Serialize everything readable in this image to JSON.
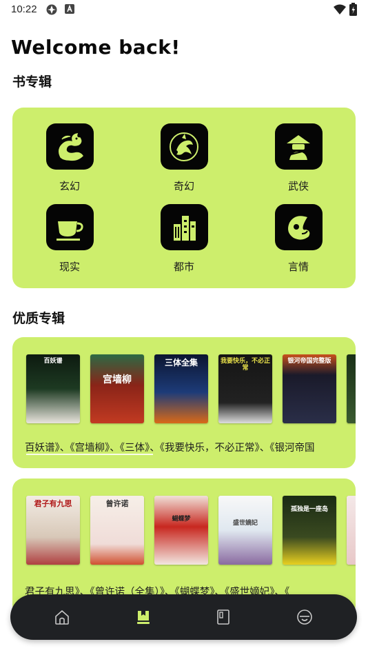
{
  "status_bar": {
    "time": "10:22"
  },
  "welcome": "Welcome back!",
  "section_categories": {
    "title": "书专辑"
  },
  "categories": [
    {
      "label": "玄幻",
      "icon": "dragon-icon"
    },
    {
      "label": "奇幻",
      "icon": "wyvern-icon"
    },
    {
      "label": "武侠",
      "icon": "martial-artist-icon"
    },
    {
      "label": "现实",
      "icon": "teacup-icon"
    },
    {
      "label": "都市",
      "icon": "city-buildings-icon"
    },
    {
      "label": "言情",
      "icon": "romance-swirl-icon"
    }
  ],
  "section_albums": {
    "title": "优质专辑"
  },
  "albums": [
    {
      "books": [
        {
          "cover_text": "百妖谱"
        },
        {
          "cover_text": "宫墙柳"
        },
        {
          "cover_text": "三体全集"
        },
        {
          "cover_text": "我要快乐，不必正常"
        },
        {
          "cover_text": "银河帝国完整版"
        },
        {
          "cover_text": ""
        }
      ],
      "caption": "百妖谱》、《宫墙柳》、《三体》、《我要快乐，不必正常》、《银河帝国"
    },
    {
      "books": [
        {
          "cover_text": "君子有九思"
        },
        {
          "cover_text": "曾许诺"
        },
        {
          "cover_text": "蝴蝶梦"
        },
        {
          "cover_text": "盛世嫡妃"
        },
        {
          "cover_text": "孤独是一座岛"
        },
        {
          "cover_text": ""
        }
      ],
      "caption": "君子有九思》、《曾许诺（全集）》、《蝴蝶梦》、《盛世嫡妃》、《"
    }
  ],
  "bottom_nav": [
    {
      "name": "home-icon",
      "active": false
    },
    {
      "name": "bookshelf-icon",
      "active": true
    },
    {
      "name": "notebook-icon",
      "active": false
    },
    {
      "name": "profile-icon",
      "active": false
    }
  ],
  "colors": {
    "accent_green": "#cdee6c",
    "nav_bg": "#1f2124",
    "nav_active": "#cdee6c"
  }
}
